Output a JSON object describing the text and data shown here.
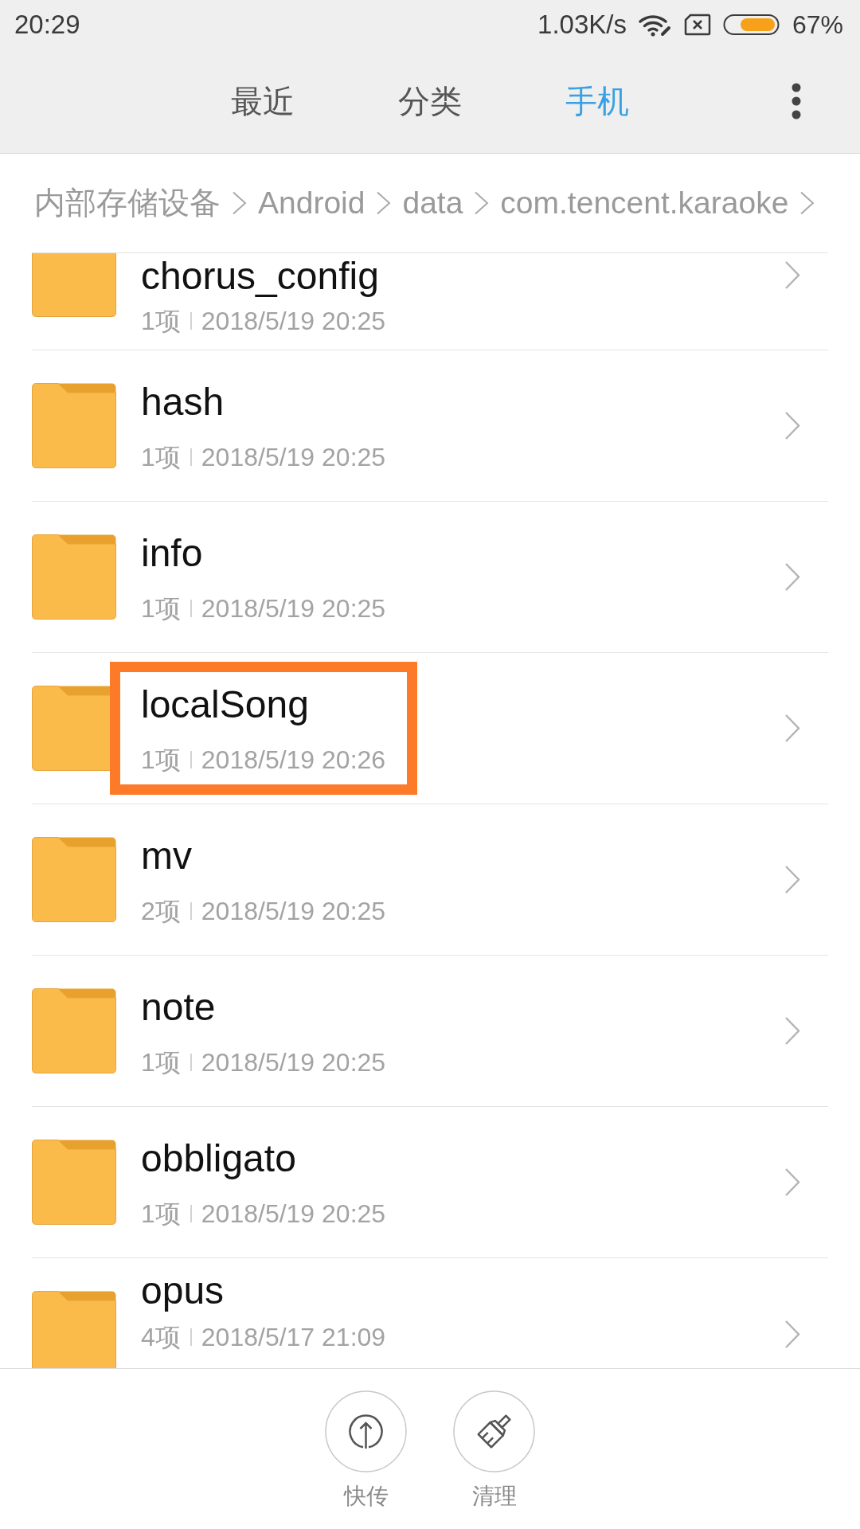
{
  "status_bar": {
    "time": "20:29",
    "net_speed": "1.03K/s",
    "battery": "67%"
  },
  "tabs": [
    {
      "label": "最近",
      "selected": false
    },
    {
      "label": "分类",
      "selected": false
    },
    {
      "label": "手机",
      "selected": true
    }
  ],
  "breadcrumb": [
    "内部存储设备",
    "Android",
    "data",
    "com.tencent.karaoke"
  ],
  "rows": [
    {
      "name": "chorus_config",
      "count": "1项",
      "date": "2018/5/19 20:25",
      "highlighted": false
    },
    {
      "name": "hash",
      "count": "1项",
      "date": "2018/5/19 20:25",
      "highlighted": false
    },
    {
      "name": "info",
      "count": "1项",
      "date": "2018/5/19 20:25",
      "highlighted": false
    },
    {
      "name": "localSong",
      "count": "1项",
      "date": "2018/5/19 20:26",
      "highlighted": true
    },
    {
      "name": "mv",
      "count": "2项",
      "date": "2018/5/19 20:25",
      "highlighted": false
    },
    {
      "name": "note",
      "count": "1项",
      "date": "2018/5/19 20:25",
      "highlighted": false
    },
    {
      "name": "obbligato",
      "count": "1项",
      "date": "2018/5/19 20:25",
      "highlighted": false
    },
    {
      "name": "opus",
      "count": "4项",
      "date": "2018/5/17 21:09",
      "highlighted": false
    }
  ],
  "actions": [
    {
      "label": "快传",
      "kind": "upload"
    },
    {
      "label": "清理",
      "kind": "clean"
    }
  ]
}
